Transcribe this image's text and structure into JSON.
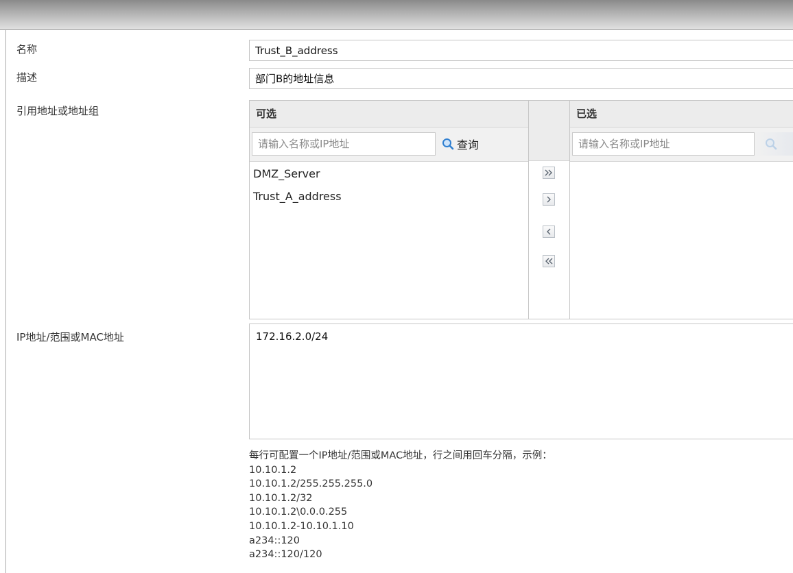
{
  "form": {
    "name_label": "名称",
    "name_value": "Trust_B_address",
    "desc_label": "描述",
    "desc_value": "部门B的地址信息",
    "ref_label": "引用地址或地址组",
    "ip_label": "IP地址/范围或MAC地址",
    "ip_value": "172.16.2.0/24",
    "help_intro": "每行可配置一个IP地址/范围或MAC地址，行之间用回车分隔，示例：",
    "help_examples": [
      "10.10.1.2",
      "10.10.1.2/255.255.255.0",
      "10.10.1.2/32",
      "10.10.1.2\\0.0.0.255",
      "10.10.1.2-10.10.1.10",
      "a234::120",
      "a234::120/120"
    ]
  },
  "transfer": {
    "available": {
      "title": "可选",
      "search_placeholder": "请输入名称或IP地址",
      "query_label": "查询",
      "items": [
        "DMZ_Server",
        "Trust_A_address"
      ]
    },
    "selected": {
      "title": "已选",
      "search_placeholder": "请输入名称或IP地址",
      "items": []
    },
    "buttons": {
      "add_all_icon": "double-chevron-right-icon",
      "add_icon": "chevron-right-icon",
      "remove_icon": "chevron-left-icon",
      "remove_all_icon": "double-chevron-left-icon"
    },
    "query_icon": "search-icon"
  },
  "colors": {
    "border": "#c4c4c4",
    "panel_header": "#ececec",
    "search_icon": "#2f7fd0",
    "text": "#333333"
  }
}
